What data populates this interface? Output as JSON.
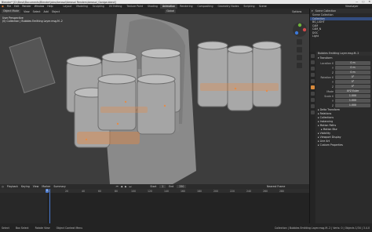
{
  "window": {
    "title": "Blender* [D:\\Desk\\Documents\\Blender\\Jobs\\Aerosol\\Aerosol Renders\\Aerosol_Ganiga.blend]"
  },
  "menu": {
    "items": [
      "File",
      "Edit",
      "Render",
      "Window",
      "Help"
    ],
    "tabs": [
      "Layout",
      "Modeling",
      "Sculpting",
      "UV Editing",
      "Texture Paint",
      "Shading",
      "Animation",
      "Rendering",
      "Compositing",
      "Geometry Nodes",
      "Scripting"
    ],
    "active_tab": "Animation",
    "scene_label": "Scene",
    "view_layer_label": "ViewLayer"
  },
  "viewport": {
    "mode": "Object Mode",
    "menus": [
      "View",
      "Select",
      "Add",
      "Object"
    ],
    "transform": "Global",
    "info_line1": "User Perspective",
    "info_line2": "(0) Collection | Bubbles Emitting Layer.msg.M..2",
    "options_label": "Options"
  },
  "outliner": {
    "header": "Scene Collection",
    "rows": [
      "Scene Collection",
      "Collection",
      "BG_LIGHT",
      "CAM",
      "CAM_N",
      "DOC",
      "Light"
    ],
    "selected_index": 1
  },
  "properties": {
    "object_name": "Bubbles Emitting Layer.msg.M..2",
    "transform_section": "Transform",
    "fields": [
      {
        "label": "Location X",
        "value": "0 m"
      },
      {
        "label": "Y",
        "value": "0 m"
      },
      {
        "label": "Z",
        "value": "0 m"
      },
      {
        "label": "Rotation X",
        "value": "0°"
      },
      {
        "label": "Y",
        "value": "0°"
      },
      {
        "label": "Z",
        "value": "0°"
      },
      {
        "label": "Mode",
        "value": "XYZ Euler"
      },
      {
        "label": "Scale X",
        "value": "1.000"
      },
      {
        "label": "Y",
        "value": "1.000"
      },
      {
        "label": "Z",
        "value": "1.000"
      }
    ],
    "sections": [
      "Delta Transform",
      "Relations",
      "Collections",
      "Instancing",
      "Motion Paths",
      "Visibility",
      "Viewport Display",
      "Line Art",
      "Custom Properties"
    ],
    "subsections": [
      "Motion Blur"
    ]
  },
  "timeline": {
    "header_items": [
      "Playback",
      "Keying",
      "View",
      "Marker"
    ],
    "show_summary_label": "Summary",
    "current_frame": "0",
    "ruler_ticks": [
      "0",
      "20",
      "40",
      "60",
      "80",
      "100",
      "120",
      "140",
      "160",
      "180",
      "200",
      "220",
      "240",
      "260",
      "280"
    ],
    "start_label": "Start",
    "start_value": "1",
    "end_label": "End",
    "end_value": "250",
    "nearest_frame_label": "Nearest Frame"
  },
  "status": {
    "items": [
      "Select",
      "Box Select",
      "Rotate View",
      "Object Context Menu"
    ],
    "right": "Collection | Bubbles Emitting Layer.msg.M..2 | Verts: 0 | Objects 1/34 | 3.4.0"
  },
  "colors": {
    "accent": "#4a7ad0",
    "particles": "#f0883a",
    "selection": "#334d80"
  }
}
